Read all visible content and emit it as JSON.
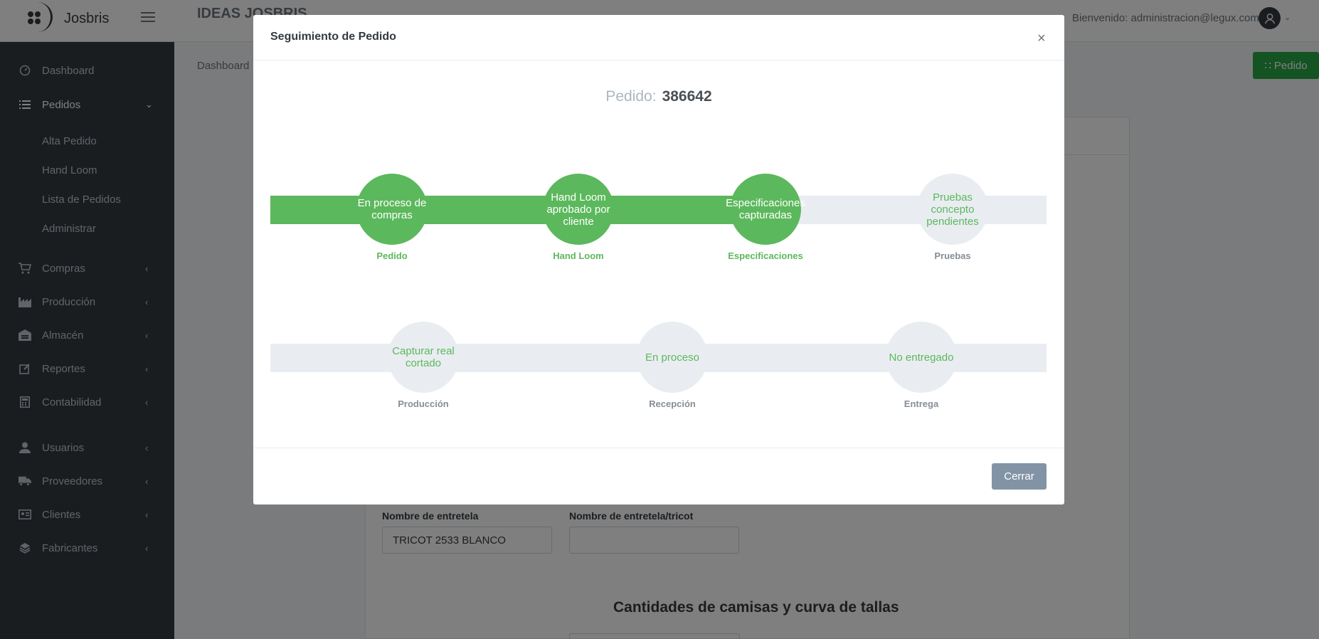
{
  "topbar": {
    "brand_name": "Josbris",
    "app_title": "IDEAS JOSBRIS",
    "welcome_text": "Bienvenido: administracion@legux.com"
  },
  "sidebar": {
    "items": [
      {
        "label": "Dashboard",
        "icon": "dashboard-icon"
      },
      {
        "label": "Pedidos",
        "icon": "list-icon"
      },
      {
        "label": "Compras",
        "icon": "cart-icon"
      },
      {
        "label": "Producción",
        "icon": "industry-icon"
      },
      {
        "label": "Almacén",
        "icon": "warehouse-icon"
      },
      {
        "label": "Reportes",
        "icon": "edit-icon"
      },
      {
        "label": "Contabilidad",
        "icon": "calculator-icon"
      },
      {
        "label": "Usuarios",
        "icon": "user-icon"
      },
      {
        "label": "Proveedores",
        "icon": "truck-icon"
      },
      {
        "label": "Clientes",
        "icon": "id-card-icon"
      },
      {
        "label": "Fabricantes",
        "icon": "layers-icon"
      }
    ],
    "pedidos_sub": [
      "Alta Pedido",
      "Hand Loom",
      "Lista de Pedidos",
      "Administrar"
    ]
  },
  "main": {
    "breadcrumb": "Dashboard",
    "pedido_button": "Pedido",
    "fields": {
      "entretela_label": "Nombre de entretela",
      "entretela_value": "TRICOT 2533 BLANCO",
      "entretela_tricot_label": "Nombre de entretela/tricot",
      "entretela_tricot_value": ""
    },
    "section_title": "Cantidades de camisas y curva de tallas"
  },
  "modal": {
    "title": "Seguimiento de Pedido",
    "close": "×",
    "order_label": "Pedido:",
    "order_number": "386642",
    "row1": [
      {
        "circle": "En proceso de compras",
        "label": "Pedido",
        "done": true
      },
      {
        "circle": "Hand Loom aprobado por cliente",
        "label": "Hand Loom",
        "done": true
      },
      {
        "circle": "Especificaciones capturadas",
        "label": "Especificaciones",
        "done": true
      },
      {
        "circle": "Pruebas concepto pendientes",
        "label": "Pruebas",
        "done": false
      }
    ],
    "row2": [
      {
        "circle": "Capturar real cortado",
        "label": "Producción",
        "done": false
      },
      {
        "circle": "En proceso",
        "label": "Recepción",
        "done": false
      },
      {
        "circle": "No entregado",
        "label": "Entrega",
        "done": false
      }
    ],
    "close_button": "Cerrar"
  },
  "colors": {
    "success": "#5cb85c",
    "sidebar": "#343a40",
    "pending": "#e9edf1",
    "secondary_button": "#8293a5"
  }
}
